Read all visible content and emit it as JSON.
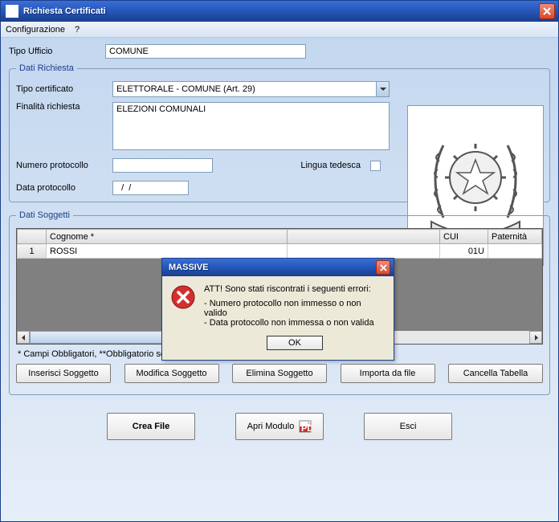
{
  "window": {
    "title": "Richiesta Certificati"
  },
  "menu": {
    "config": "Configurazione",
    "help": "?"
  },
  "form": {
    "tipo_ufficio_label": "Tipo Ufficio",
    "tipo_ufficio_value": "COMUNE",
    "dati_richiesta_legend": "Dati Richiesta",
    "tipo_certificato_label": "Tipo certificato",
    "tipo_certificato_value": "ELETTORALE - COMUNE (Art. 29)",
    "finalita_label": "Finalità richiesta",
    "finalita_value": "ELEZIONI COMUNALI",
    "numero_protocollo_label": "Numero protocollo",
    "numero_protocollo_value": "",
    "lingua_tedesca_label": "Lingua tedesca",
    "lingua_tedesca_checked": false,
    "data_protocollo_label": "Data protocollo",
    "data_protocollo_value": "  /  /"
  },
  "soggetti": {
    "legend": "Dati Soggetti",
    "columns": {
      "rownum": "",
      "cognome": "Cognome *",
      "cui": "CUI",
      "paternita": "Paternità"
    },
    "rows": [
      {
        "num": "1",
        "cognome": "ROSSI",
        "cui_suffix": "01U",
        "paternita": ""
      }
    ],
    "footnote": "* Campi Obbligatori, **Obbligatorio se nato in Italia"
  },
  "buttons": {
    "inserisci": "Inserisci Soggetto",
    "modifica": "Modifica Soggetto",
    "elimina": "Elimina Soggetto",
    "importa": "Importa da file",
    "cancella": "Cancella Tabella",
    "crea_file": "Crea File",
    "apri_modulo": "Apri Modulo",
    "esci": "Esci"
  },
  "modal": {
    "title": "MASSIVE",
    "heading": "ATT! Sono stati riscontrati i seguenti errori:",
    "err1": "- Numero protocollo non immesso o non valido",
    "err2": "- Data protocollo non immessa o non valida",
    "ok": "OK"
  }
}
